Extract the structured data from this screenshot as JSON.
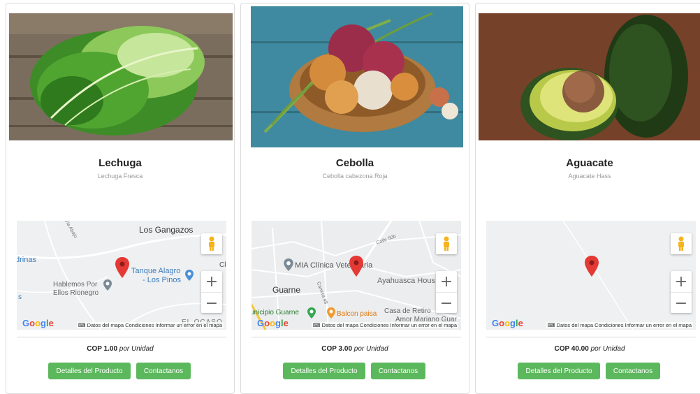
{
  "products": [
    {
      "name": "Lechuga",
      "description": "Lechuga Fresca",
      "price": "COP 1.00",
      "unit": "por Unidad",
      "details_label": "Detalles del Producto",
      "contact_label": "Contactanos",
      "map": {
        "labels": [
          "Los Gangazos",
          "drinas",
          "Tanque Alagro",
          "- Los Pinos",
          "Hablemos Por",
          "Ellos Rionegro",
          "EL OCASO",
          "Clu",
          "s",
          "Vía Abajo"
        ]
      }
    },
    {
      "name": "Cebolla",
      "description": "Cebolla cabezona Roja",
      "price": "COP 3.00",
      "unit": "por Unidad",
      "details_label": "Detalles del Producto",
      "contact_label": "Contactanos",
      "map": {
        "labels": [
          "MIA Clínica Veterinaria",
          "Ayahuasca Hous",
          "Guarne",
          "unicipio Guarne",
          "Balcon paisa",
          "Casa de Retiro",
          "Amor Mariano Guar",
          "Calle 50b",
          "Carrera 48"
        ]
      }
    },
    {
      "name": "Aguacate",
      "description": "Aguacate Hass",
      "price": "COP 40.00",
      "unit": "por Unidad",
      "details_label": "Detalles del Producto",
      "contact_label": "Contactanos",
      "map": {
        "labels": []
      }
    }
  ],
  "map_common": {
    "google_logo": "Google",
    "keyboard_icon": "keyboard-icon",
    "attribution": "Datos del mapa   Condiciones   Informar un error en el mapa",
    "zoom_in": "+",
    "zoom_out": "−"
  },
  "colors": {
    "button_green": "#5cb85c",
    "marker_red": "#e53935"
  }
}
